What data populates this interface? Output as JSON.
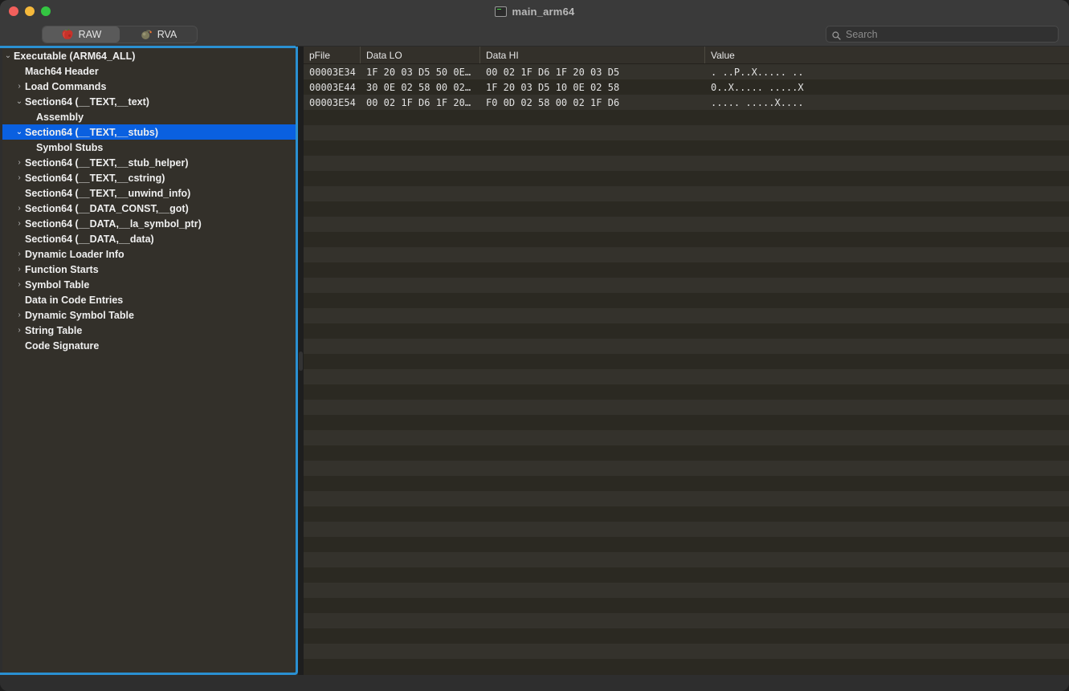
{
  "window": {
    "title": "main_arm64",
    "title_icon": "terminal-icon",
    "controls": [
      "close",
      "minimize",
      "maximize"
    ]
  },
  "toolbar": {
    "tabs": [
      {
        "label": "RAW",
        "icon": "apple-icon",
        "active": true
      },
      {
        "label": "RVA",
        "icon": "bomb-icon",
        "active": false
      }
    ],
    "search": {
      "placeholder": "Search",
      "value": "",
      "icon": "search-icon"
    }
  },
  "sidebar": {
    "items": [
      {
        "label": "Executable  (ARM64_ALL)",
        "indent": 0,
        "twisty": "expanded",
        "selected": false
      },
      {
        "label": "Mach64 Header",
        "indent": 1,
        "twisty": "none",
        "selected": false
      },
      {
        "label": "Load Commands",
        "indent": 1,
        "twisty": "collapsed",
        "selected": false
      },
      {
        "label": "Section64 (__TEXT,__text)",
        "indent": 1,
        "twisty": "expanded",
        "selected": false
      },
      {
        "label": "Assembly",
        "indent": 2,
        "twisty": "none",
        "selected": false
      },
      {
        "label": "Section64 (__TEXT,__stubs)",
        "indent": 1,
        "twisty": "expanded",
        "selected": true
      },
      {
        "label": "Symbol Stubs",
        "indent": 2,
        "twisty": "none",
        "selected": false
      },
      {
        "label": "Section64 (__TEXT,__stub_helper)",
        "indent": 1,
        "twisty": "collapsed",
        "selected": false
      },
      {
        "label": "Section64 (__TEXT,__cstring)",
        "indent": 1,
        "twisty": "collapsed",
        "selected": false
      },
      {
        "label": "Section64 (__TEXT,__unwind_info)",
        "indent": 1,
        "twisty": "none",
        "selected": false
      },
      {
        "label": "Section64 (__DATA_CONST,__got)",
        "indent": 1,
        "twisty": "collapsed",
        "selected": false
      },
      {
        "label": "Section64 (__DATA,__la_symbol_ptr)",
        "indent": 1,
        "twisty": "collapsed",
        "selected": false
      },
      {
        "label": "Section64 (__DATA,__data)",
        "indent": 1,
        "twisty": "none",
        "selected": false
      },
      {
        "label": "Dynamic Loader Info",
        "indent": 1,
        "twisty": "collapsed",
        "selected": false
      },
      {
        "label": "Function Starts",
        "indent": 1,
        "twisty": "collapsed",
        "selected": false
      },
      {
        "label": "Symbol Table",
        "indent": 1,
        "twisty": "collapsed",
        "selected": false
      },
      {
        "label": "Data in Code Entries",
        "indent": 1,
        "twisty": "none",
        "selected": false
      },
      {
        "label": "Dynamic Symbol Table",
        "indent": 1,
        "twisty": "collapsed",
        "selected": false
      },
      {
        "label": "String Table",
        "indent": 1,
        "twisty": "collapsed",
        "selected": false
      },
      {
        "label": "Code Signature",
        "indent": 1,
        "twisty": "none",
        "selected": false
      }
    ]
  },
  "table": {
    "columns": [
      {
        "label": "pFile",
        "key": "pfile"
      },
      {
        "label": "Data LO",
        "key": "lo"
      },
      {
        "label": "Data HI",
        "key": "hi"
      },
      {
        "label": "Value",
        "key": "value"
      }
    ],
    "rows": [
      {
        "pfile": "00003E34",
        "lo": "1F 20 03 D5 50 0E…",
        "hi": "00 02 1F D6 1F 20 03 D5",
        "value": ". ..P..X..... .."
      },
      {
        "pfile": "00003E44",
        "lo": "30 0E 02 58 00 02…",
        "hi": "1F 20 03 D5 10 0E 02 58",
        "value": "0..X..... .....X"
      },
      {
        "pfile": "00003E54",
        "lo": "00 02 1F D6 1F 20…",
        "hi": "F0 0D 02 58 00 02 1F D6",
        "value": "..... .....X...."
      }
    ],
    "empty_row_count": 37
  },
  "colors": {
    "selection_blue": "#0a60e0",
    "focus_ring_blue": "#2a90d2",
    "row_odd": "#34322c",
    "row_even": "#2b2922",
    "panel_bg": "#33302a",
    "chrome_bg": "#3a3a3a"
  }
}
